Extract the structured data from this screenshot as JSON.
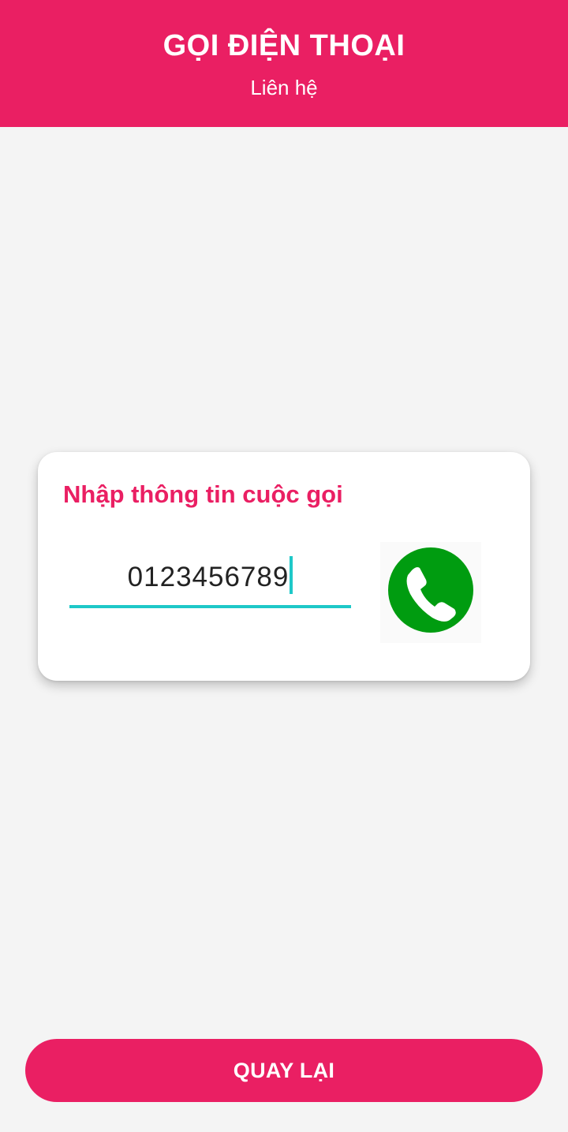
{
  "header": {
    "title": "GỌI ĐIỆN THOẠI",
    "subtitle": "Liên hệ"
  },
  "card": {
    "title": "Nhập thông tin cuộc gọi",
    "phone_input": {
      "value": "0123456789"
    },
    "call_button_icon": "phone-call-icon"
  },
  "footer": {
    "back_label": "QUAY LẠI"
  },
  "colors": {
    "primary": "#ea1f63",
    "accent": "#1ec8c8",
    "call_green": "#009c10",
    "background": "#f4f4f4"
  }
}
